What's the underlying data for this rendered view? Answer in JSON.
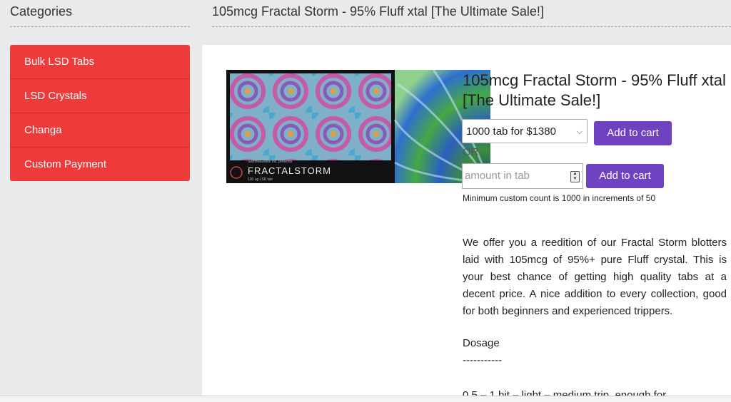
{
  "sidebar": {
    "title": "Categories",
    "items": [
      {
        "label": "Bulk LSD Tabs"
      },
      {
        "label": "LSD Crystals"
      },
      {
        "label": "Changa"
      },
      {
        "label": "Custom Payment"
      }
    ]
  },
  "page": {
    "title": "105mcg Fractal Storm - 95% Fluff xtal [The Ultimate Sale!]"
  },
  "product": {
    "heading": "105mcg Fractal Storm - 95% Fluff xtal [The Ultimate Sale!]",
    "image": {
      "presents": "GammaGoblin Inc. presents",
      "brand": "FRACTALSTORM",
      "sub": "100 ug LSD tab"
    },
    "option_selected": "1000 tab for $1380",
    "add_to_cart_label": "Add to cart",
    "or_label": "OR",
    "amount_placeholder": "amount in tab",
    "add_to_cart_label_2": "Add to cart",
    "min_note": "Minimum custom count is 1000 in increments of 50",
    "description": "We offer you a reedition of our Fractal Storm blotters laid with 105mcg of 95%+ pure Fluff crystal. This is your best chance of getting high quality tabs at a decent price. A nice addition to every collection, good for both beginners and experienced trippers.",
    "dosage_title": "Dosage",
    "dosage_rule": "-----------",
    "dosage_line": "0.5 – 1 bit – light – medium trip, enough for"
  },
  "colors": {
    "menu_bg": "#ef3a3a",
    "button_bg": "#6f42c1",
    "page_bg": "#e9eaec"
  }
}
